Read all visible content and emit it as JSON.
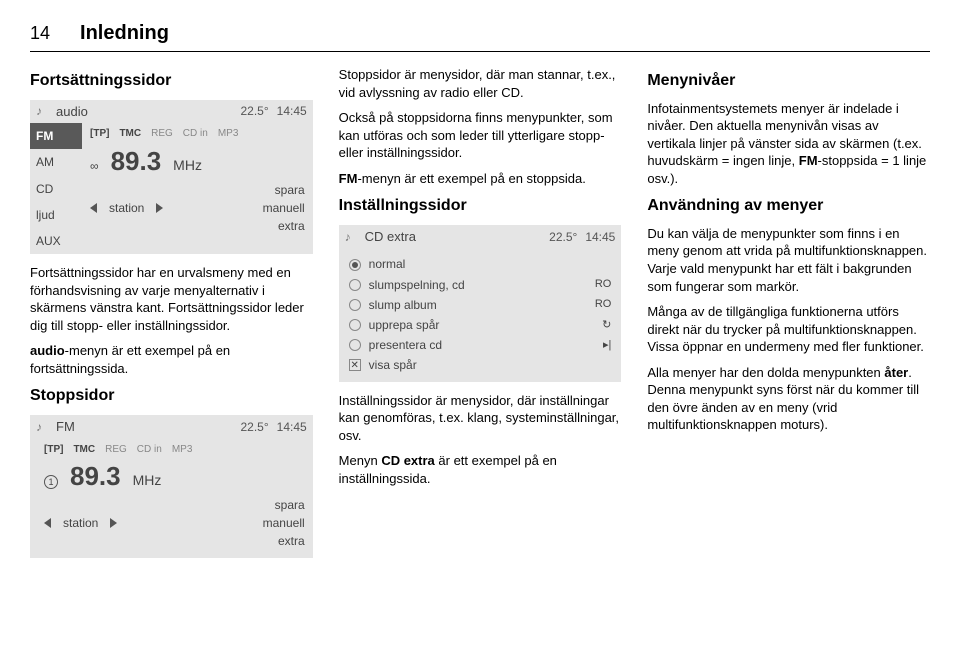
{
  "header": {
    "page_num": "14",
    "chapter": "Inledning"
  },
  "col1": {
    "h_fort": "Fortsättningssidor",
    "p_fort": "Fortsättningssidor har en urvalsmeny med en förhandsvisning av varje menyalternativ i skärmens vänstra kant. Fortsättningssidor leder dig till stopp- eller inställningssidor.",
    "p_audio": "audio-menyn är ett exempel på en fortsättningssida.",
    "b_audio": "audio",
    "h_stopp": "Stoppsidor"
  },
  "col2": {
    "p_stop1": "Stoppsidor är menysidor, där man stannar, t.ex., vid avlyssning av radio eller CD.",
    "p_stop2": "Också på stoppsidorna finns menypunkter, som kan utföras och som leder till ytterligare stopp- eller inställningssidor.",
    "p_fm": "FM-menyn är ett exempel på en stoppsida.",
    "b_fm": "FM",
    "h_inst": "Inställningssidor",
    "p_inst1": "Inställningssidor är menysidor, där inställningar kan genomföras, t.ex. klang, systeminställningar, osv.",
    "p_cd": "Menyn CD extra är ett exempel på en inställningssida.",
    "b_cd": "CD extra"
  },
  "col3": {
    "h_niv": "Menynivåer",
    "p_niv": "Infotainmentsystemets menyer är indelade i nivåer. Den aktuella menynivån visas av vertikala linjer på vänster sida av skärmen (t.ex. huvudskärm = ingen linje, FM-stoppsida = 1 linje osv.).",
    "b_fm2": "FM",
    "h_anv": "Användning av menyer",
    "p_anv1": "Du kan välja de menypunkter som finns i en meny genom att vrida på multifunktionsknappen. Varje vald menypunkt har ett fält i bakgrunden som fungerar som markör.",
    "p_anv2": "Många av de tillgängliga funktionerna utförs direkt när du trycker på multifunktionsknappen. Vissa öppnar en undermeny med fler funktioner.",
    "p_anv3": "Alla menyer har den dolda menypunkten åter. Denna menypunkt syns först när du kommer till den övre änden av en meny (vrid multifunktionsknappen moturs).",
    "b_ater": "åter"
  },
  "scr_audio": {
    "title": "audio",
    "temp": "22.5°",
    "time": "14:45",
    "side": [
      "FM",
      "AM",
      "CD",
      "ljud",
      "AUX"
    ],
    "tags": [
      "[TP]",
      "TMC",
      "REG",
      "CD in",
      "MP3"
    ],
    "freq": "89.3",
    "unit": "MHz",
    "prev": "◂◂",
    "next": "▸▸",
    "ctl": [
      "station",
      "spara",
      "manuell",
      "extra"
    ]
  },
  "scr_fm": {
    "title": "FM",
    "temp": "22.5°",
    "time": "14:45",
    "tags": [
      "[TP]",
      "TMC",
      "REG",
      "CD in",
      "MP3"
    ],
    "preset": "1",
    "freq": "89.3",
    "unit": "MHz",
    "ctl": [
      "station",
      "spara",
      "manuell",
      "extra"
    ]
  },
  "scr_cd": {
    "title": "CD extra",
    "temp": "22.5°",
    "time": "14:45",
    "items": [
      {
        "type": "radio",
        "on": true,
        "label": "normal",
        "tail": ""
      },
      {
        "type": "radio",
        "on": false,
        "label": "slumpspelning, cd",
        "tail": "RO"
      },
      {
        "type": "radio",
        "on": false,
        "label": "slump album",
        "tail": "RO"
      },
      {
        "type": "radio",
        "on": false,
        "label": "upprepa spår",
        "tail": "↻"
      },
      {
        "type": "radio",
        "on": false,
        "label": "presentera cd",
        "tail": "▸|"
      },
      {
        "type": "check",
        "on": true,
        "label": "visa spår",
        "tail": ""
      }
    ]
  }
}
